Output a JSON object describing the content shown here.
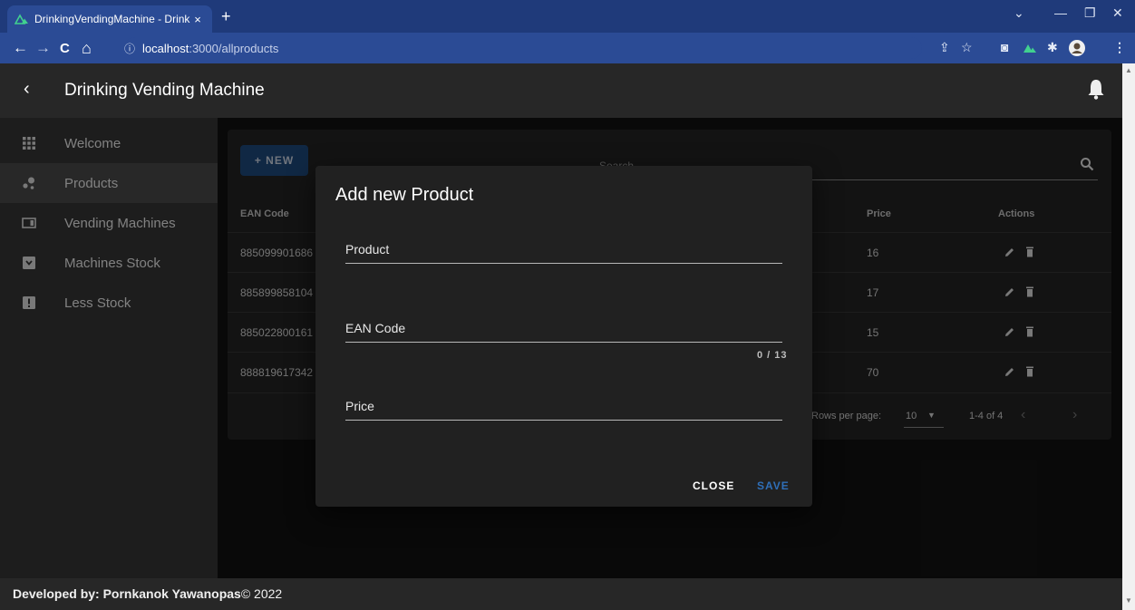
{
  "browser": {
    "tab_title": "DrinkingVendingMachine - Drink",
    "tab_close": "×",
    "new_tab": "+",
    "url_host": "localhost",
    "url_path": ":3000/allproducts",
    "info_icon": "ⓘ",
    "window_controls": {
      "chevron": "⌄",
      "minimize": "—",
      "restore": "❐",
      "close": "✕"
    },
    "nav": {
      "back": "←",
      "forward": "→",
      "reload": "C",
      "home": "⌂"
    },
    "toolbar_icons": {
      "share": "⇪",
      "star": "☆",
      "camera": "◙",
      "ext": "✱",
      "menu": "⋮"
    }
  },
  "appbar": {
    "back": "‹",
    "title": "Drinking Vending Machine"
  },
  "sidebar": {
    "items": [
      {
        "label": "Welcome",
        "icon": "grid-icon"
      },
      {
        "label": "Products",
        "icon": "bubble-chart-icon",
        "active": true
      },
      {
        "label": "Vending Machines",
        "icon": "vending-icon"
      },
      {
        "label": "Machines Stock",
        "icon": "stock-icon"
      },
      {
        "label": "Less Stock",
        "icon": "alert-icon"
      }
    ]
  },
  "main": {
    "new_button": "+ NEW",
    "search_label": "Search",
    "columns": {
      "ean": "EAN Code",
      "price": "Price",
      "actions": "Actions"
    },
    "rows": [
      {
        "ean": "885099901686",
        "price": "16"
      },
      {
        "ean": "885899858104",
        "price": "17"
      },
      {
        "ean": "885022800161",
        "price": "15"
      },
      {
        "ean": "888819617342",
        "price": "70"
      }
    ],
    "footer": {
      "rows_per_page_label": "Rows per page:",
      "rows_per_page_value": "10",
      "range": "1-4 of 4",
      "prev": "‹",
      "next": "›"
    }
  },
  "dialog": {
    "title": "Add new Product",
    "fields": [
      {
        "label": "Product"
      },
      {
        "label": "EAN Code",
        "counter": "0 / 13"
      },
      {
        "label": "Price"
      }
    ],
    "close_label": "CLOSE",
    "save_label": "SAVE"
  },
  "footer": {
    "prefix": "Developed by: Pornkanok Yawanopas",
    "suffix": "© 2022"
  },
  "colors": {
    "tabstrip": "#1f3a7a",
    "toolbar": "#2b4b95",
    "appbar": "#272727",
    "sidebar": "#363636",
    "primary": "#1f4a7f",
    "save": "#2f6fb8"
  }
}
